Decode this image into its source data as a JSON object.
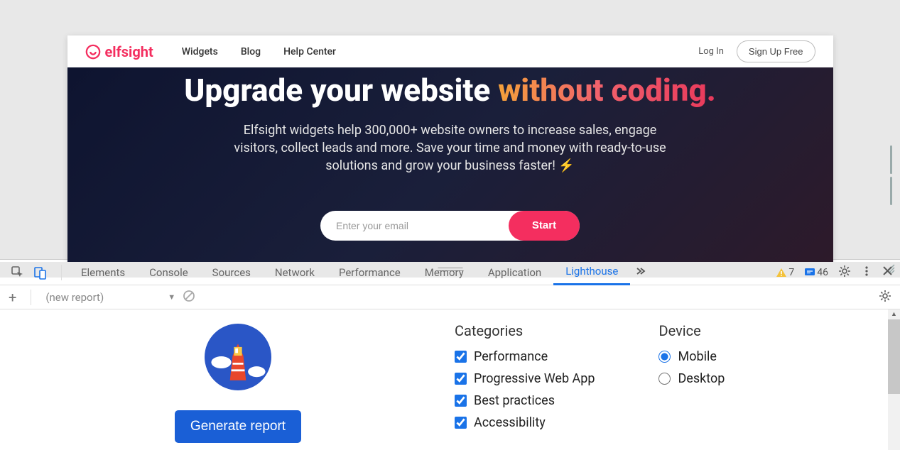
{
  "page": {
    "brand": "elfsight",
    "nav": [
      "Widgets",
      "Blog",
      "Help Center"
    ],
    "login": "Log In",
    "signup": "Sign Up Free",
    "hero": {
      "heading_pre": "Upgrade your website ",
      "heading_accent": "without coding.",
      "subtitle": "Elfsight widgets help 300,000+ website owners to increase sales, engage visitors, collect leads and more. Save your time and money with ready-to-use solutions and grow your business faster! ⚡",
      "email_placeholder": "Enter your email",
      "start": "Start"
    }
  },
  "devtools": {
    "tabs": [
      "Elements",
      "Console",
      "Sources",
      "Network",
      "Performance",
      "Memory",
      "Application",
      "Lighthouse"
    ],
    "active_tab": "Lighthouse",
    "warnings": "7",
    "messages": "46",
    "new_report": "(new report)",
    "generate": "Generate report",
    "categories_title": "Categories",
    "categories": [
      "Performance",
      "Progressive Web App",
      "Best practices",
      "Accessibility"
    ],
    "device_title": "Device",
    "devices": [
      "Mobile",
      "Desktop"
    ]
  }
}
